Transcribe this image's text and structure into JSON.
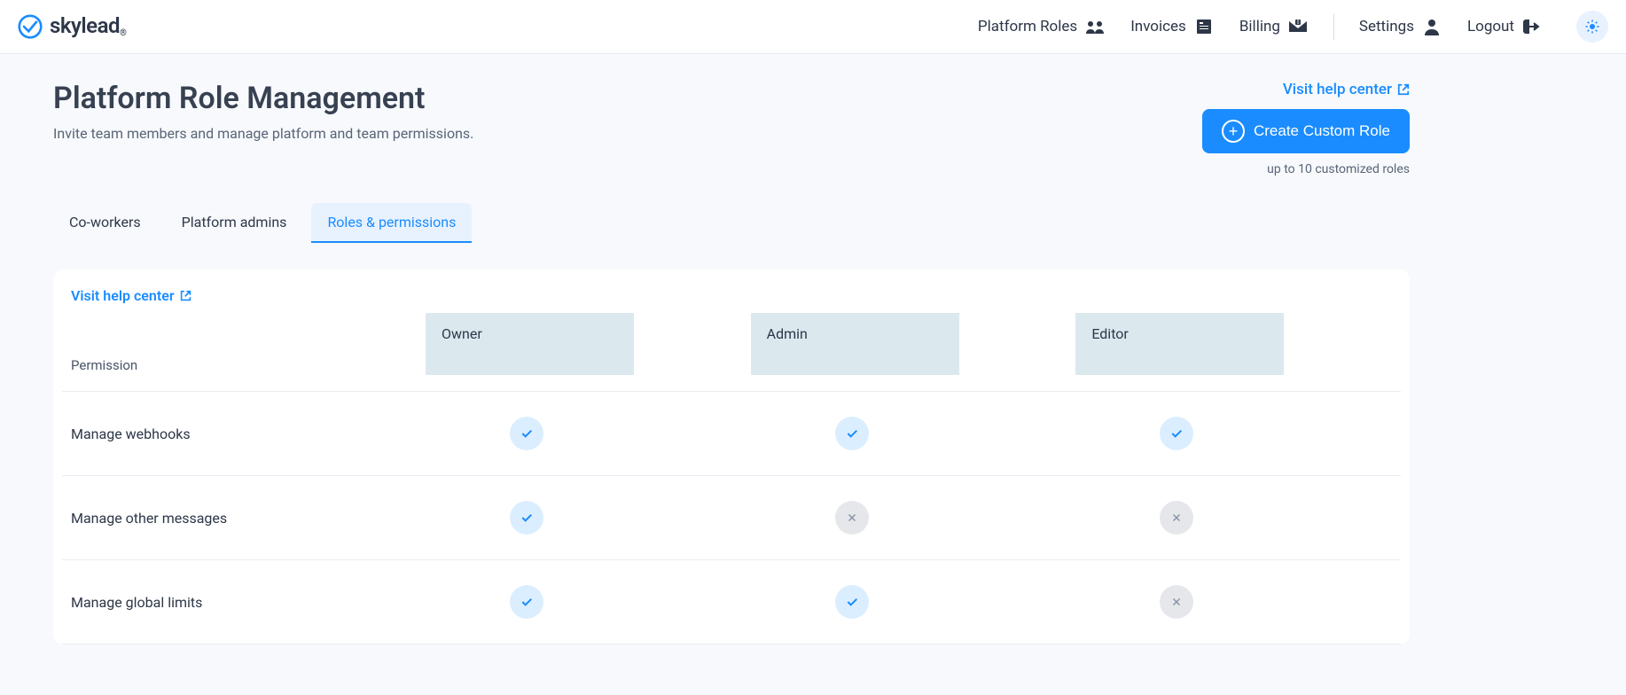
{
  "brand": {
    "name": "skylead"
  },
  "nav": {
    "items": [
      {
        "label": "Platform Roles",
        "icon": "roles"
      },
      {
        "label": "Invoices",
        "icon": "invoice"
      },
      {
        "label": "Billing",
        "icon": "billing"
      },
      {
        "label": "Settings",
        "icon": "user"
      },
      {
        "label": "Logout",
        "icon": "logout"
      }
    ]
  },
  "page": {
    "title": "Platform Role Management",
    "subtitle": "Invite team members and manage platform and team permissions.",
    "help_link": "Visit help center",
    "create_button": "Create Custom Role",
    "roles_limit": "up to 10 customized roles"
  },
  "tabs": [
    {
      "label": "Co-workers",
      "active": false
    },
    {
      "label": "Platform admins",
      "active": false
    },
    {
      "label": "Roles & permissions",
      "active": true
    }
  ],
  "card": {
    "help_link": "Visit help center"
  },
  "table": {
    "permission_header": "Permission",
    "roles": [
      "Owner",
      "Admin",
      "Editor"
    ],
    "rows": [
      {
        "name": "Manage webhooks",
        "values": [
          true,
          true,
          true
        ]
      },
      {
        "name": "Manage other messages",
        "values": [
          true,
          false,
          false
        ]
      },
      {
        "name": "Manage global limits",
        "values": [
          true,
          true,
          false
        ]
      }
    ]
  }
}
